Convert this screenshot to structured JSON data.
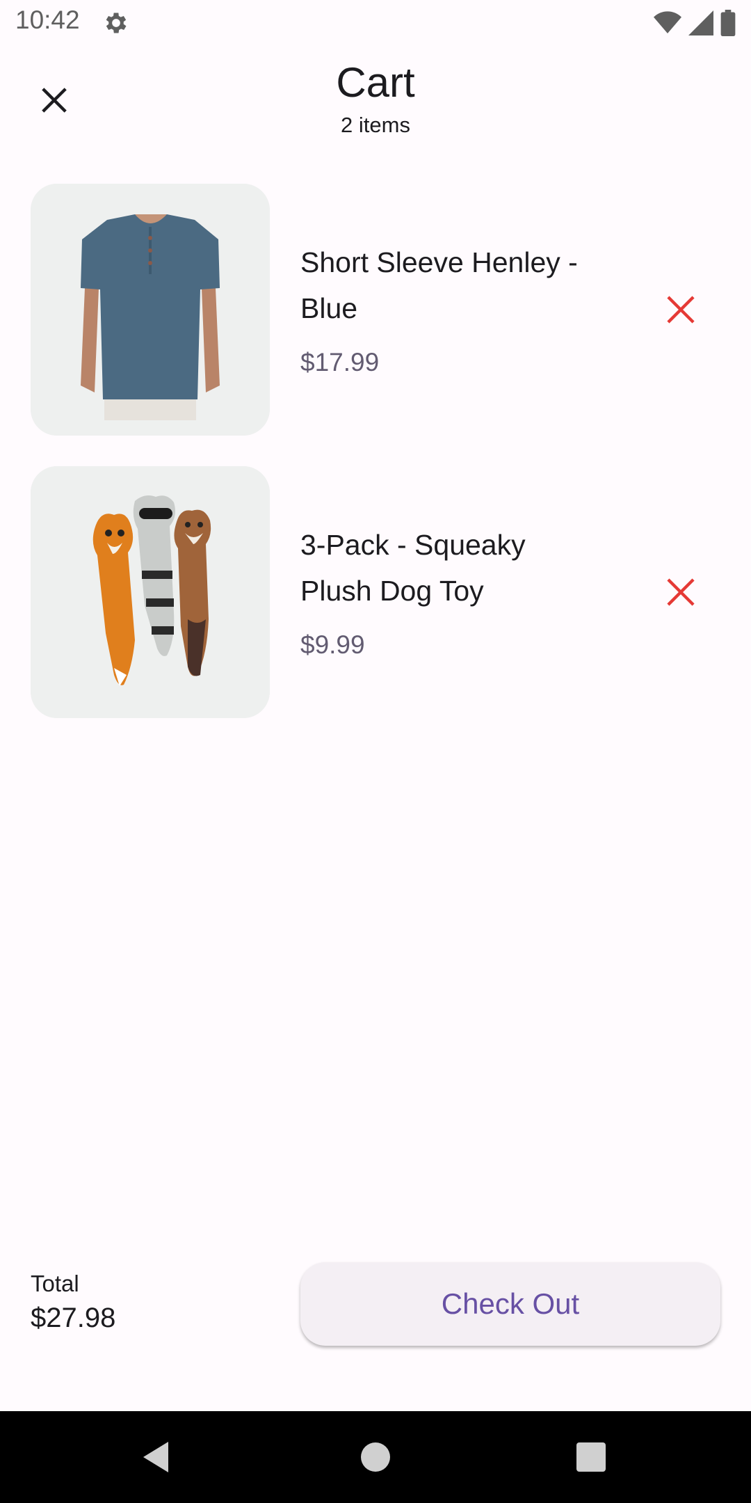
{
  "status_bar": {
    "time": "10:42",
    "icons": [
      "gear-icon",
      "wifi-icon",
      "signal-icon",
      "battery-icon"
    ]
  },
  "header": {
    "title": "Cart",
    "subtitle": "2 items",
    "close_icon": "close-icon"
  },
  "cart": {
    "items": [
      {
        "name_line1": "Short Sleeve Henley -",
        "name_line2": "Blue",
        "price": "$17.99",
        "image": "blue henley t-shirt photo"
      },
      {
        "name_line1": "3-Pack - Squeaky",
        "name_line2": "Plush Dog Toy",
        "price": "$9.99",
        "image": "plush fox, raccoon and fox dog toys photo"
      }
    ]
  },
  "footer": {
    "total_label": "Total",
    "total_value": "$27.98",
    "checkout_label": "Check Out"
  },
  "colors": {
    "background": "#fffbfe",
    "accent": "#6750a4",
    "remove": "#e53935",
    "price": "#625b71"
  },
  "nav_bar": {
    "icons": [
      "back-icon",
      "home-icon",
      "recents-icon"
    ]
  }
}
